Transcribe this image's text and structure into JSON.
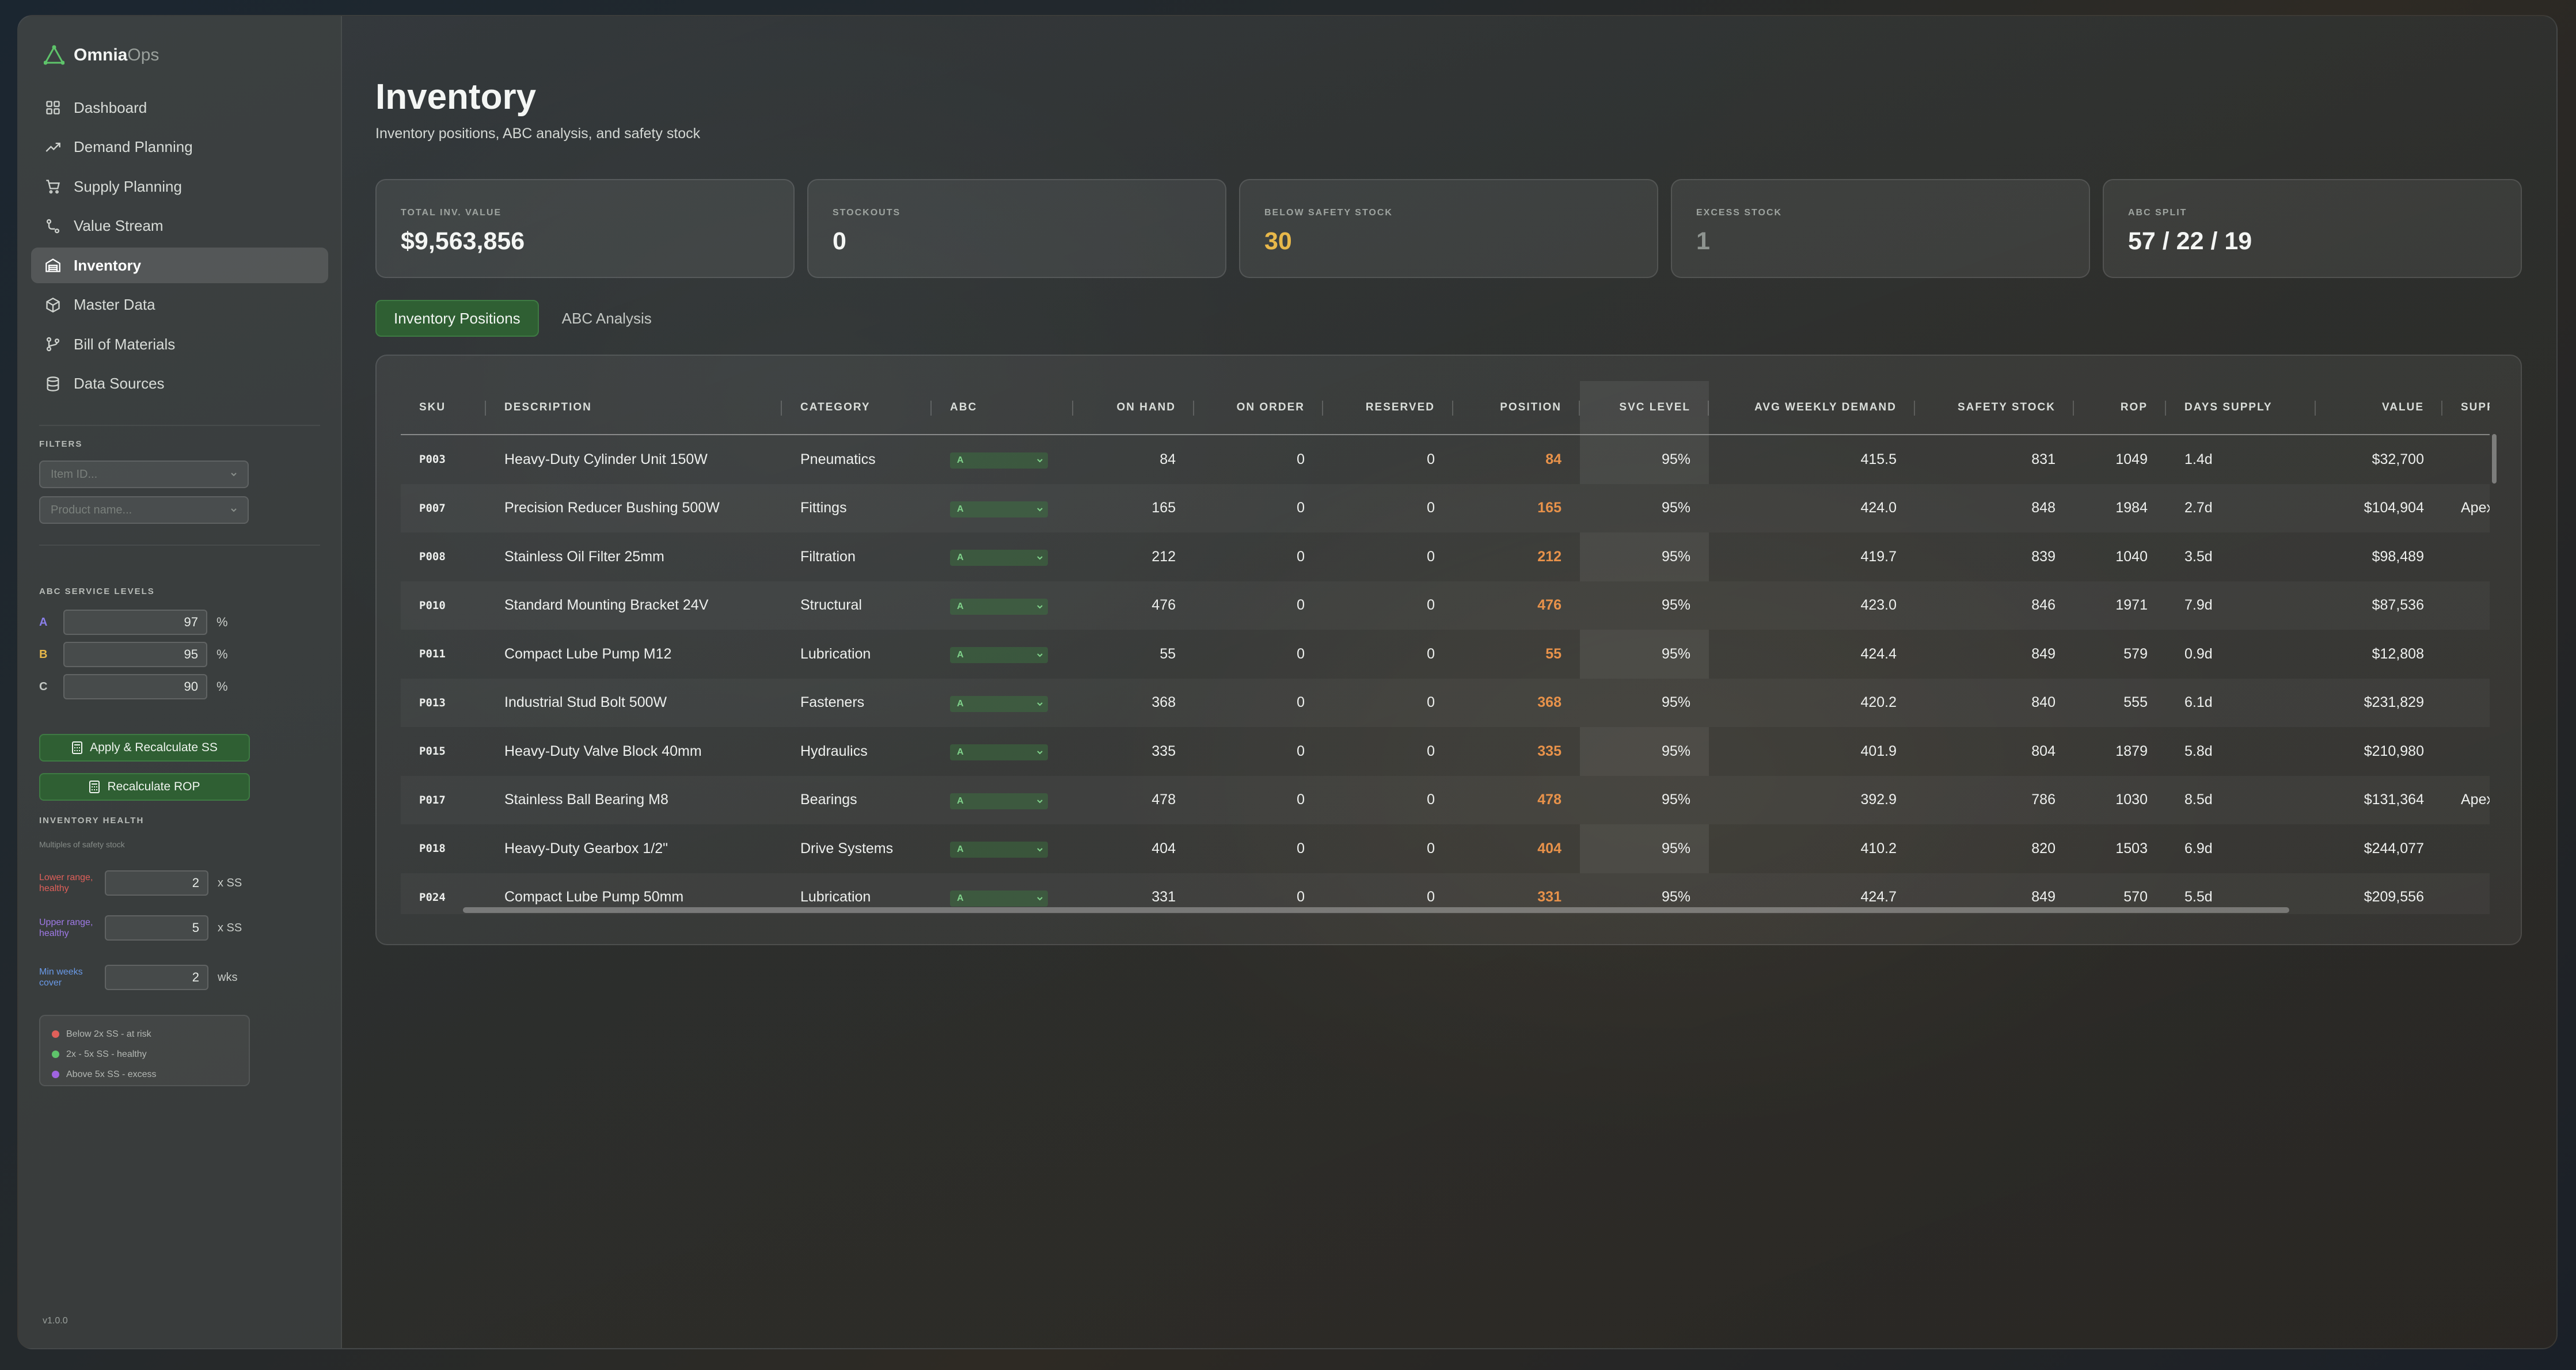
{
  "brand": {
    "name": "Omnia",
    "suffix": "Ops"
  },
  "nav": [
    {
      "label": "Dashboard",
      "icon": "dashboard-icon",
      "active": false
    },
    {
      "label": "Demand Planning",
      "icon": "trending-up-icon",
      "active": false
    },
    {
      "label": "Supply Planning",
      "icon": "cart-icon",
      "active": false
    },
    {
      "label": "Value Stream",
      "icon": "route-icon",
      "active": false
    },
    {
      "label": "Inventory",
      "icon": "warehouse-icon",
      "active": true
    },
    {
      "label": "Master Data",
      "icon": "box-icon",
      "active": false
    },
    {
      "label": "Bill of Materials",
      "icon": "branch-icon",
      "active": false
    },
    {
      "label": "Data Sources",
      "icon": "database-icon",
      "active": false
    }
  ],
  "filters": {
    "title": "FILTERS",
    "item_placeholder": "Item ID...",
    "product_placeholder": "Product name..."
  },
  "service_levels": {
    "title": "ABC SERVICE LEVELS",
    "rows": [
      {
        "letter": "A",
        "value": "97",
        "unit": "%",
        "color": "#8a7fe8"
      },
      {
        "letter": "B",
        "value": "95",
        "unit": "%",
        "color": "#e8b84a"
      },
      {
        "letter": "C",
        "value": "90",
        "unit": "%",
        "color": "#c4c8c4"
      }
    ],
    "apply_button": "Apply & Recalculate SS",
    "rop_button": "Recalculate ROP"
  },
  "health": {
    "title": "INVENTORY HEALTH",
    "subtitle": "Multiples of safety stock",
    "rows": [
      {
        "label": "Lower range, healthy",
        "value": "2",
        "unit": "x SS",
        "color": "#e0605a"
      },
      {
        "label": "Upper range, healthy",
        "value": "5",
        "unit": "x SS",
        "color": "#a07ae8"
      },
      {
        "label": "Min weeks cover",
        "value": "2",
        "unit": "wks",
        "color": "#6a9ae8"
      }
    ],
    "legend": [
      {
        "label": "Below 2x SS - at risk",
        "color": "#e0605a"
      },
      {
        "label": "2x - 5x SS - healthy",
        "color": "#5ec46a"
      },
      {
        "label": "Above 5x SS - excess",
        "color": "#a064e0"
      }
    ]
  },
  "version": "v1.0.0",
  "page": {
    "title": "Inventory",
    "subtitle": "Inventory positions, ABC analysis, and safety stock"
  },
  "kpis": [
    {
      "label": "TOTAL INV. VALUE",
      "value": "$9,563,856",
      "color": "#f4f6f4"
    },
    {
      "label": "STOCKOUTS",
      "value": "0",
      "color": "#f4f6f4"
    },
    {
      "label": "BELOW SAFETY STOCK",
      "value": "30",
      "color": "#e8b84a"
    },
    {
      "label": "EXCESS STOCK",
      "value": "1",
      "color": "#8e9490"
    },
    {
      "label": "ABC SPLIT",
      "value": "57 / 22 / 19",
      "color": "#f4f6f4"
    }
  ],
  "tabs": [
    {
      "label": "Inventory Positions",
      "active": true
    },
    {
      "label": "ABC Analysis",
      "active": false
    }
  ],
  "table": {
    "columns": [
      "SKU",
      "DESCRIPTION",
      "CATEGORY",
      "ABC",
      "ON HAND",
      "ON ORDER",
      "RESERVED",
      "POSITION",
      "SVC LEVEL",
      "AVG WEEKLY DEMAND",
      "SAFETY STOCK",
      "ROP",
      "DAYS SUPPLY",
      "VALUE",
      "SUPPLIER"
    ],
    "rows": [
      {
        "sku": "P003",
        "description": "Heavy-Duty Cylinder Unit 150W",
        "category": "Pneumatics",
        "abc": "A",
        "on_hand": "84",
        "on_order": "0",
        "reserved": "0",
        "position": "84",
        "svc": "95%",
        "avg_demand": "415.5",
        "safety_stock": "831",
        "rop": "1049",
        "days_supply": "1.4d",
        "value": "$32,700",
        "supplier": ""
      },
      {
        "sku": "P007",
        "description": "Precision Reducer Bushing 500W",
        "category": "Fittings",
        "abc": "A",
        "on_hand": "165",
        "on_order": "0",
        "reserved": "0",
        "position": "165",
        "svc": "95%",
        "avg_demand": "424.0",
        "safety_stock": "848",
        "rop": "1984",
        "days_supply": "2.7d",
        "value": "$104,904",
        "supplier": "Apex"
      },
      {
        "sku": "P008",
        "description": "Stainless Oil Filter 25mm",
        "category": "Filtration",
        "abc": "A",
        "on_hand": "212",
        "on_order": "0",
        "reserved": "0",
        "position": "212",
        "svc": "95%",
        "avg_demand": "419.7",
        "safety_stock": "839",
        "rop": "1040",
        "days_supply": "3.5d",
        "value": "$98,489",
        "supplier": ""
      },
      {
        "sku": "P010",
        "description": "Standard Mounting Bracket 24V",
        "category": "Structural",
        "abc": "A",
        "on_hand": "476",
        "on_order": "0",
        "reserved": "0",
        "position": "476",
        "svc": "95%",
        "avg_demand": "423.0",
        "safety_stock": "846",
        "rop": "1971",
        "days_supply": "7.9d",
        "value": "$87,536",
        "supplier": ""
      },
      {
        "sku": "P011",
        "description": "Compact Lube Pump M12",
        "category": "Lubrication",
        "abc": "A",
        "on_hand": "55",
        "on_order": "0",
        "reserved": "0",
        "position": "55",
        "svc": "95%",
        "avg_demand": "424.4",
        "safety_stock": "849",
        "rop": "579",
        "days_supply": "0.9d",
        "value": "$12,808",
        "supplier": ""
      },
      {
        "sku": "P013",
        "description": "Industrial Stud Bolt 500W",
        "category": "Fasteners",
        "abc": "A",
        "on_hand": "368",
        "on_order": "0",
        "reserved": "0",
        "position": "368",
        "svc": "95%",
        "avg_demand": "420.2",
        "safety_stock": "840",
        "rop": "555",
        "days_supply": "6.1d",
        "value": "$231,829",
        "supplier": ""
      },
      {
        "sku": "P015",
        "description": "Heavy-Duty Valve Block 40mm",
        "category": "Hydraulics",
        "abc": "A",
        "on_hand": "335",
        "on_order": "0",
        "reserved": "0",
        "position": "335",
        "svc": "95%",
        "avg_demand": "401.9",
        "safety_stock": "804",
        "rop": "1879",
        "days_supply": "5.8d",
        "value": "$210,980",
        "supplier": ""
      },
      {
        "sku": "P017",
        "description": "Stainless Ball Bearing M8",
        "category": "Bearings",
        "abc": "A",
        "on_hand": "478",
        "on_order": "0",
        "reserved": "0",
        "position": "478",
        "svc": "95%",
        "avg_demand": "392.9",
        "safety_stock": "786",
        "rop": "1030",
        "days_supply": "8.5d",
        "value": "$131,364",
        "supplier": "Apex"
      },
      {
        "sku": "P018",
        "description": "Heavy-Duty Gearbox 1/2\"",
        "category": "Drive Systems",
        "abc": "A",
        "on_hand": "404",
        "on_order": "0",
        "reserved": "0",
        "position": "404",
        "svc": "95%",
        "avg_demand": "410.2",
        "safety_stock": "820",
        "rop": "1503",
        "days_supply": "6.9d",
        "value": "$244,077",
        "supplier": ""
      },
      {
        "sku": "P024",
        "description": "Compact Lube Pump 50mm",
        "category": "Lubrication",
        "abc": "A",
        "on_hand": "331",
        "on_order": "0",
        "reserved": "0",
        "position": "331",
        "svc": "95%",
        "avg_demand": "424.7",
        "safety_stock": "849",
        "rop": "570",
        "days_supply": "5.5d",
        "value": "$209,556",
        "supplier": ""
      }
    ]
  }
}
